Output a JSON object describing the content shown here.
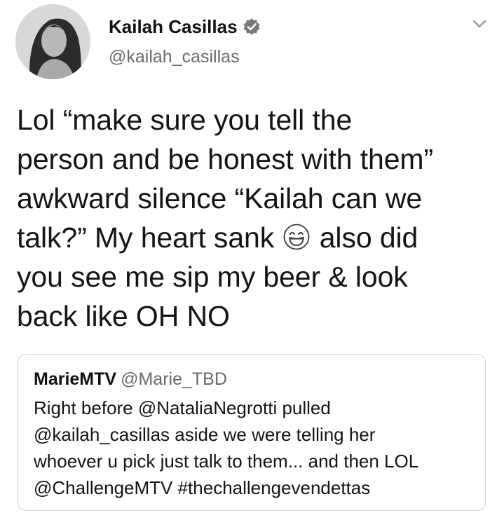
{
  "author": {
    "name": "Kailah Casillas",
    "handle": "@kailah_casillas",
    "verified_icon": "verified-badge-icon",
    "avatar_icon": "avatar"
  },
  "menu": {
    "icon": "chevron-down-icon"
  },
  "tweet": {
    "lines": [
      "Lol “make sure you tell the",
      "person and be honest with them”",
      "awkward silence “Kailah can we",
      "talk?” My heart sank",
      "also did",
      "you see me sip my beer & look",
      "back like OH NO"
    ],
    "emoji": "grinning-face-icon"
  },
  "quoted_tweet": {
    "name": "MarieMTV",
    "handle": "@Marie_TBD",
    "lines": [
      "Right before @NataliaNegrotti pulled",
      "@kailah_casillas aside we were telling her",
      "whoever u pick just talk to them... and then LOL",
      "@ChallengeMTV #thechallengevendettas"
    ]
  },
  "colors": {
    "text": "#141414",
    "secondary_text": "#6a6a6a",
    "border": "#d6d6d6",
    "badge": "#7a7a7a"
  }
}
